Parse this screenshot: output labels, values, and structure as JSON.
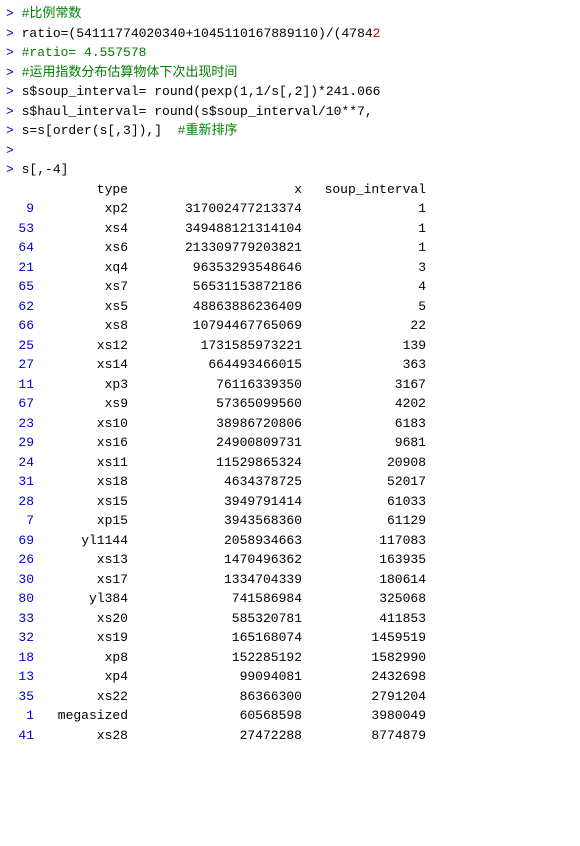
{
  "console": {
    "lines": [
      {
        "type": "comment_line",
        "prompt": ">",
        "text": " #比例常数"
      },
      {
        "type": "code_line",
        "prompt": ">",
        "text": " ratio=(54111774020340+1045110167889110)/(4784"
      },
      {
        "type": "code_line",
        "prompt": ">",
        "text": " #ratio= 4.557578"
      },
      {
        "type": "code_line",
        "prompt": ">",
        "text": " #运用指数分布估算物体下次出现时间"
      },
      {
        "type": "code_line",
        "prompt": ">",
        "text": " s$soup_interval= round(pexp(1,1/s[,2])*241.066"
      },
      {
        "type": "code_line",
        "prompt": ">",
        "text": " s$haul_interval= round(s$soup_interval/10**7,"
      },
      {
        "type": "code_line",
        "prompt": ">",
        "text": " s=s[order(s[,3]),]  #重新排序"
      },
      {
        "type": "empty_prompt",
        "prompt": ">",
        "text": ""
      },
      {
        "type": "code_line",
        "prompt": ">",
        "text": " s[,-4]"
      }
    ],
    "table": {
      "header": {
        "col_type": "type",
        "col_x": "x",
        "col_soup": "soup_interval"
      },
      "rows": [
        {
          "rownum": "9",
          "type": "xp2",
          "x": "317002477213374",
          "soup": "1"
        },
        {
          "rownum": "53",
          "type": "xs4",
          "x": "349488121314104",
          "soup": "1"
        },
        {
          "rownum": "64",
          "type": "xs6",
          "x": "213309779203821",
          "soup": "1"
        },
        {
          "rownum": "21",
          "type": "xq4",
          "x": "96353293548646",
          "soup": "3"
        },
        {
          "rownum": "65",
          "type": "xs7",
          "x": "56531153872186",
          "soup": "4"
        },
        {
          "rownum": "62",
          "type": "xs5",
          "x": "48863886236409",
          "soup": "5"
        },
        {
          "rownum": "66",
          "type": "xs8",
          "x": "10794467765069",
          "soup": "22"
        },
        {
          "rownum": "25",
          "type": "xs12",
          "x": "1731585973221",
          "soup": "139"
        },
        {
          "rownum": "27",
          "type": "xs14",
          "x": "664493466015",
          "soup": "363"
        },
        {
          "rownum": "11",
          "type": "xp3",
          "x": "76116339350",
          "soup": "3167"
        },
        {
          "rownum": "67",
          "type": "xs9",
          "x": "57365099560",
          "soup": "4202"
        },
        {
          "rownum": "23",
          "type": "xs10",
          "x": "38986720806",
          "soup": "6183"
        },
        {
          "rownum": "29",
          "type": "xs16",
          "x": "24900809731",
          "soup": "9681"
        },
        {
          "rownum": "24",
          "type": "xs11",
          "x": "11529865324",
          "soup": "20908"
        },
        {
          "rownum": "31",
          "type": "xs18",
          "x": "4634378725",
          "soup": "52017"
        },
        {
          "rownum": "28",
          "type": "xs15",
          "x": "3949791414",
          "soup": "61033"
        },
        {
          "rownum": "7",
          "type": "xp15",
          "x": "3943568360",
          "soup": "61129"
        },
        {
          "rownum": "69",
          "type": "yl1144",
          "x": "2058934663",
          "soup": "117083"
        },
        {
          "rownum": "26",
          "type": "xs13",
          "x": "1470496362",
          "soup": "163935"
        },
        {
          "rownum": "30",
          "type": "xs17",
          "x": "1334704339",
          "soup": "180614"
        },
        {
          "rownum": "80",
          "type": "yl384",
          "x": "741586984",
          "soup": "325068"
        },
        {
          "rownum": "33",
          "type": "xs20",
          "x": "585320781",
          "soup": "411853"
        },
        {
          "rownum": "32",
          "type": "xs19",
          "x": "165168074",
          "soup": "1459519"
        },
        {
          "rownum": "18",
          "type": "xp8",
          "x": "152285192",
          "soup": "1582990"
        },
        {
          "rownum": "13",
          "type": "xp4",
          "x": "99094081",
          "soup": "2432698"
        },
        {
          "rownum": "35",
          "type": "xs22",
          "x": "86366300",
          "soup": "2791204"
        },
        {
          "rownum": "1",
          "type": "megasized",
          "x": "60568598",
          "soup": "3980049"
        },
        {
          "rownum": "41",
          "type": "xs28",
          "x": "27472288",
          "soup": "8774879"
        }
      ]
    }
  }
}
